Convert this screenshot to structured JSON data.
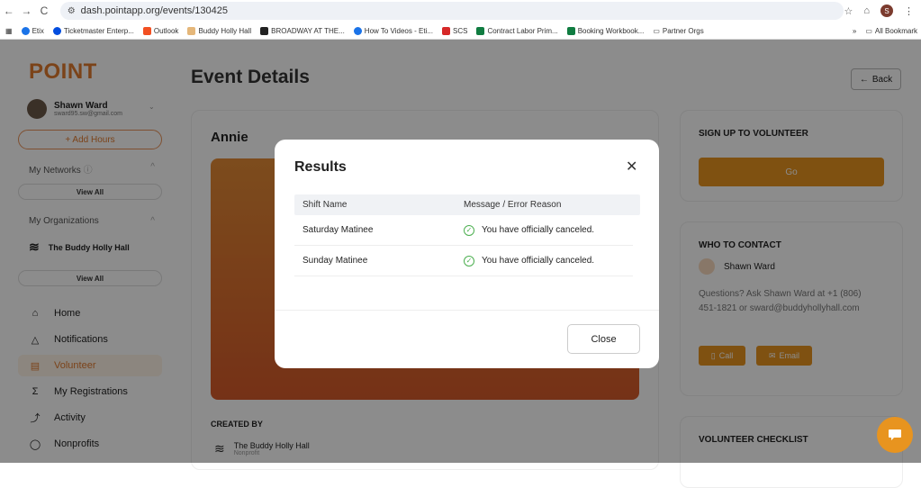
{
  "browser": {
    "url": "dash.pointapp.org/events/130425",
    "bookmarks": [
      "Etix",
      "Ticketmaster Enterp...",
      "Outlook",
      "Buddy Holly Hall",
      "BROADWAY AT THE...",
      "How To Videos - Eti...",
      "SCS",
      "Contract Labor Prim...",
      "Booking Workbook...",
      "Partner Orgs"
    ],
    "all_bookmarks": "All Bookmark",
    "profile_initial": "S",
    "more": "»"
  },
  "sidebar": {
    "logo": "POINT",
    "user_name": "Shawn Ward",
    "user_email": "sward95.sw@gmail.com",
    "add_hours": "+ Add Hours",
    "my_networks": "My Networks",
    "my_organizations": "My Organizations",
    "view_all": "View All",
    "org_name": "The Buddy Holly Hall",
    "nav": [
      {
        "label": "Home",
        "icon": "home-icon",
        "glyph": "⌂"
      },
      {
        "label": "Notifications",
        "icon": "bell-icon",
        "glyph": "♫"
      },
      {
        "label": "Volunteer",
        "icon": "calendar-icon",
        "glyph": "▤"
      },
      {
        "label": "My Registrations",
        "icon": "registrations-icon",
        "glyph": "Σ"
      },
      {
        "label": "Activity",
        "icon": "activity-icon",
        "glyph": "〽"
      },
      {
        "label": "Nonprofits",
        "icon": "nonprofits-icon",
        "glyph": "◯"
      }
    ]
  },
  "main": {
    "page_title": "Event Details",
    "back": "Back",
    "event_name": "Annie",
    "created_by": "CREATED BY",
    "created_org": "The Buddy Holly Hall",
    "created_org_type": "Nonprofit"
  },
  "right": {
    "signup_title": "SIGN UP TO VOLUNTEER",
    "go": "Go",
    "contact_title": "WHO TO CONTACT",
    "contact_name": "Shawn Ward",
    "contact_text": "Questions? Ask Shawn Ward at +1 (806) 451-1821 or sward@buddyhollyhall.com",
    "call": "Call",
    "email": "Email",
    "checklist_title": "VOLUNTEER CHECKLIST"
  },
  "modal": {
    "title": "Results",
    "col1": "Shift Name",
    "col2": "Message / Error Reason",
    "rows": [
      {
        "shift": "Saturday Matinee",
        "message": "You have officially canceled."
      },
      {
        "shift": "Sunday Matinee",
        "message": "You have officially canceled."
      }
    ],
    "close_button": "Close"
  },
  "colors": {
    "accent": "#e8941f",
    "brand": "#e07a2e"
  }
}
